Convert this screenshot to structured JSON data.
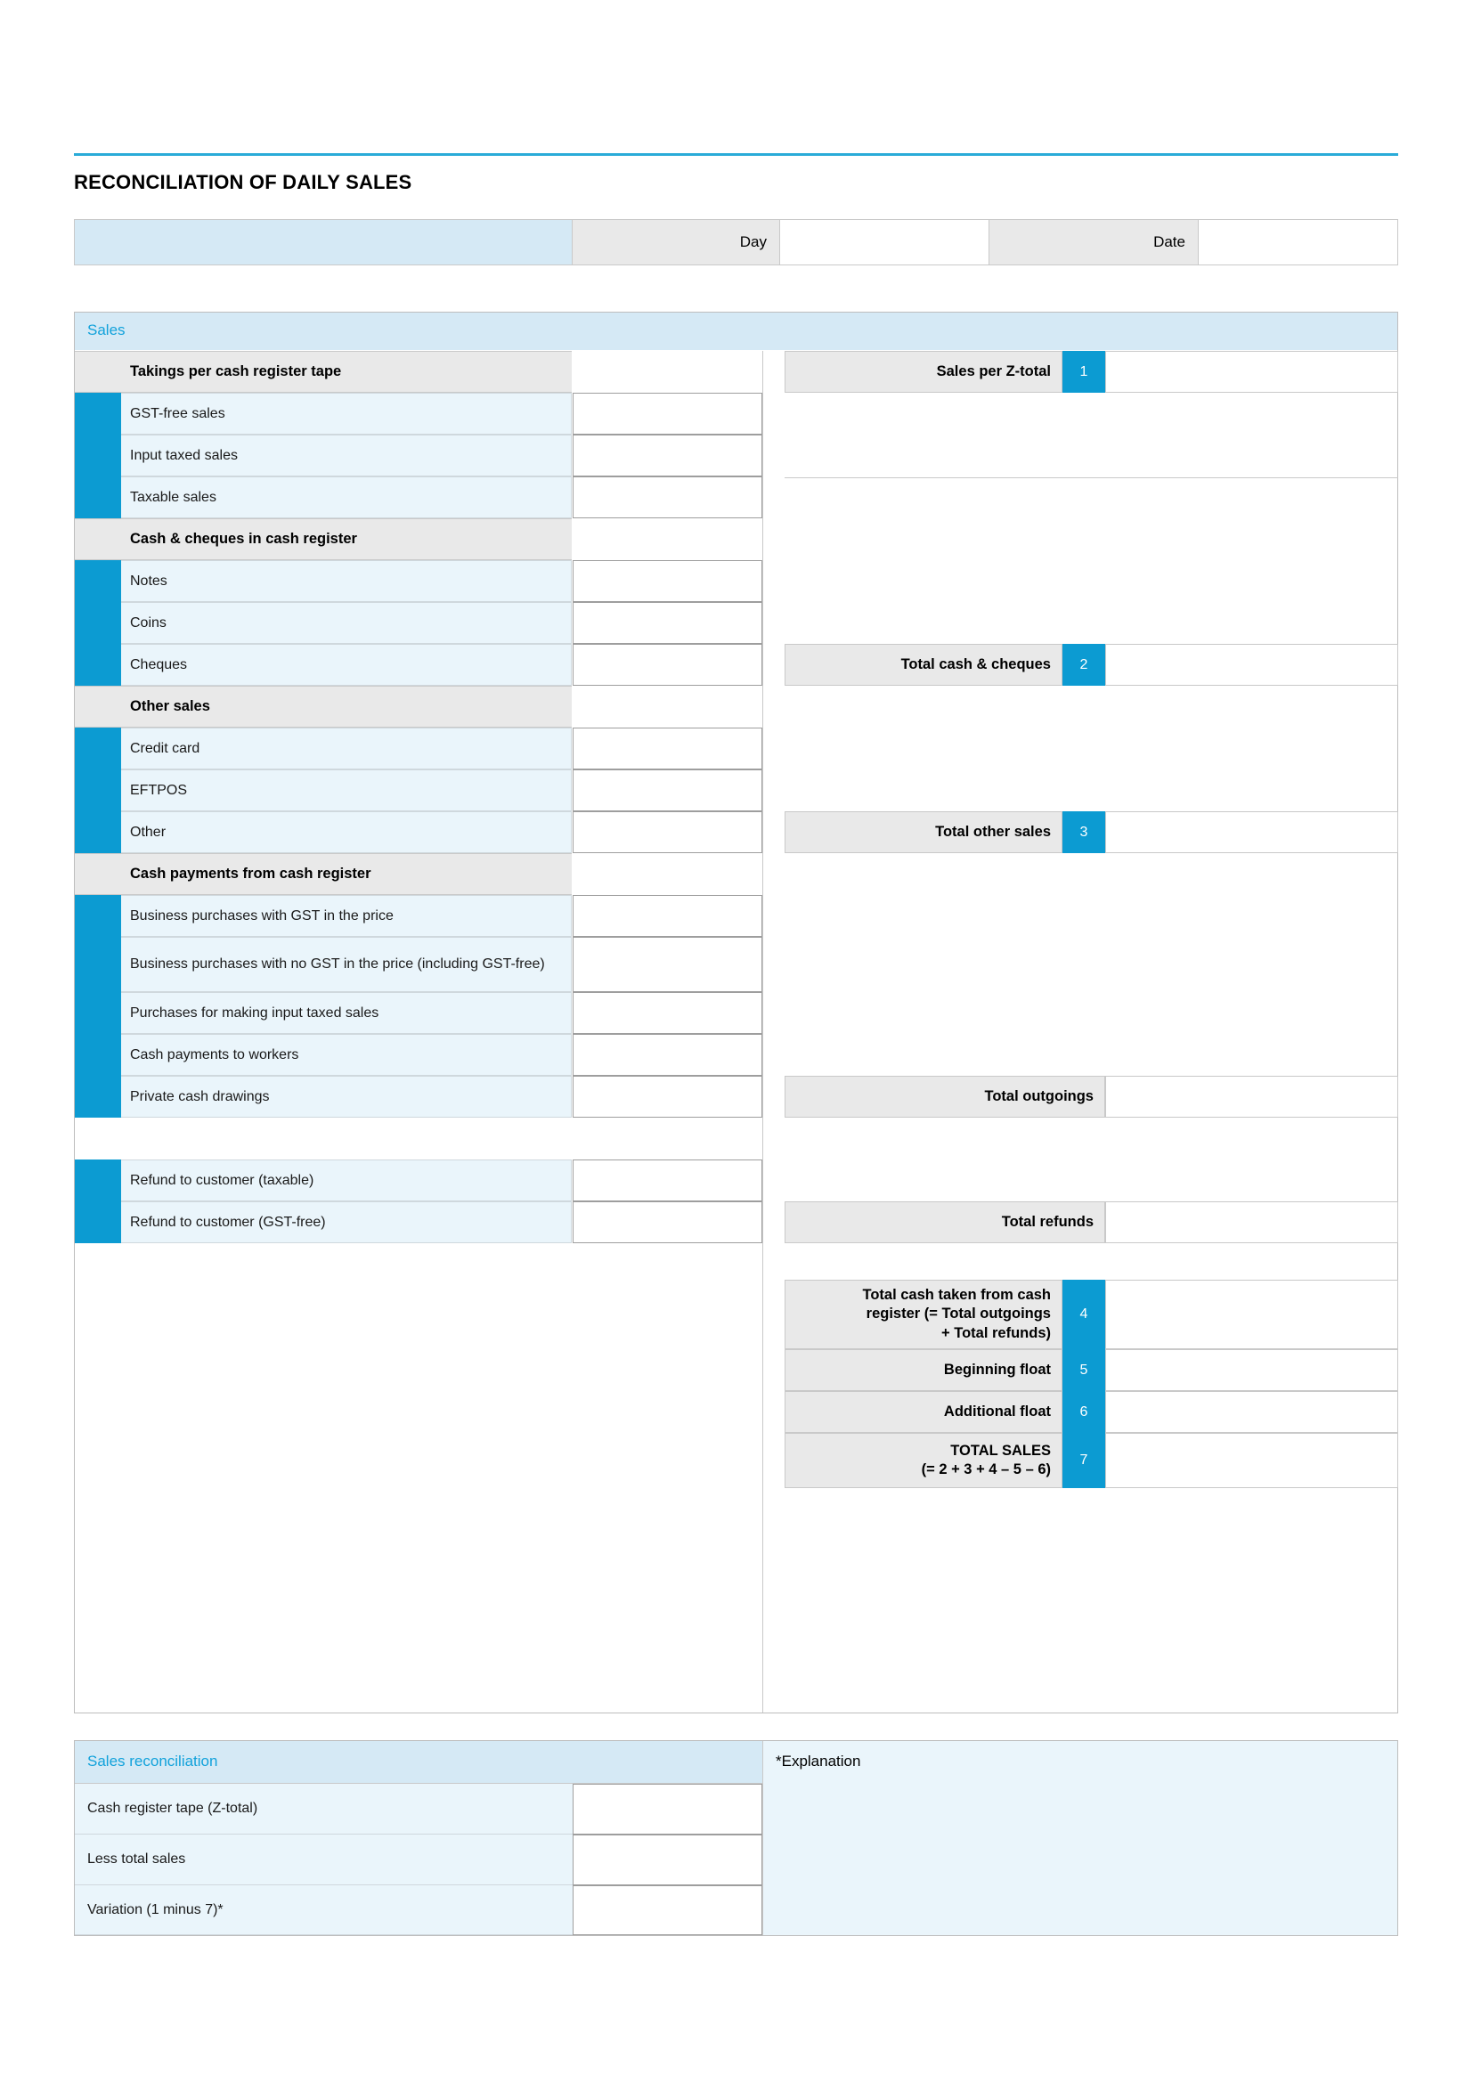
{
  "document": {
    "title": "RECONCILIATION OF DAILY SALES",
    "accent_blue": "#0C9BD2",
    "rule_blue": "#29ABD8",
    "header_light_blue": "#d5e9f5",
    "row_light_blue": "#eaf5fb",
    "grey": "#e9e9e9"
  },
  "header": {
    "day_label": "Day",
    "date_label": "Date",
    "day_value": "",
    "date_value": ""
  },
  "sales_section": {
    "title": "Sales",
    "groups": [
      {
        "category": "Takings per cash register tape",
        "category_value": "",
        "items": [
          {
            "label": "GST-free sales",
            "value": ""
          },
          {
            "label": "Input taxed sales",
            "value": ""
          },
          {
            "label": "Taxable sales",
            "value": ""
          }
        ]
      },
      {
        "category": "Cash & cheques in cash register",
        "category_value": "",
        "items": [
          {
            "label": "Notes",
            "value": ""
          },
          {
            "label": "Coins",
            "value": ""
          },
          {
            "label": "Cheques",
            "value": ""
          }
        ]
      },
      {
        "category": "Other sales",
        "category_value": "",
        "items": [
          {
            "label": "Credit card",
            "value": ""
          },
          {
            "label": "EFTPOS",
            "value": ""
          },
          {
            "label": "Other",
            "value": ""
          }
        ]
      },
      {
        "category": "Cash payments from cash register",
        "category_value": "",
        "items": [
          {
            "label": "Business purchases with GST in the price",
            "value": ""
          },
          {
            "label": "Business purchases with no GST in the price (including GST-free)",
            "value": ""
          },
          {
            "label": "Purchases for making input taxed sales",
            "value": ""
          },
          {
            "label": "Cash payments to workers",
            "value": ""
          },
          {
            "label": "Private cash drawings",
            "value": ""
          }
        ]
      },
      {
        "category": "",
        "category_value": "",
        "items": [
          {
            "label": "Refund to customer (taxable)",
            "value": ""
          },
          {
            "label": "Refund to customer (GST-free)",
            "value": ""
          }
        ]
      }
    ],
    "totals": [
      {
        "label": "Sales per Z-total",
        "number": "1",
        "value": ""
      },
      {
        "label": "Total cash & cheques",
        "number": "2",
        "value": ""
      },
      {
        "label": "Total other sales",
        "number": "3",
        "value": ""
      },
      {
        "label": "Total outgoings",
        "number": "",
        "value": ""
      },
      {
        "label": "Total refunds",
        "number": "",
        "value": ""
      },
      {
        "label": "Total cash taken from cash register  (= Total outgoings + Total refunds)",
        "number": "4",
        "value": ""
      },
      {
        "label": "Beginning float",
        "number": "5",
        "value": ""
      },
      {
        "label": "Additional float",
        "number": "6",
        "value": ""
      },
      {
        "label": "TOTAL SALES (= 2 + 3 + 4 – 5 – 6)",
        "number": "7",
        "value": ""
      }
    ],
    "total_labels": {
      "sales_z_total": "Sales per Z-total",
      "total_cash_cheques": "Total cash & cheques",
      "total_other_sales": "Total other sales",
      "total_outgoings": "Total outgoings",
      "total_refunds": "Total refunds",
      "total_cash_taken_line1": "Total cash taken from cash",
      "total_cash_taken_line2": "register  (= Total outgoings",
      "total_cash_taken_line3": "+ Total refunds)",
      "beginning_float": "Beginning float",
      "additional_float": "Additional float",
      "total_sales_line1": "TOTAL SALES",
      "total_sales_line2": "(= 2 + 3 + 4 – 5 – 6)"
    },
    "numbers": {
      "n1": "1",
      "n2": "2",
      "n3": "3",
      "n4": "4",
      "n5": "5",
      "n6": "6",
      "n7": "7"
    }
  },
  "reconciliation": {
    "title": "Sales reconciliation",
    "rows": [
      {
        "label": "Cash register tape (Z-total)",
        "value": ""
      },
      {
        "label": "Less total sales",
        "value": ""
      },
      {
        "label": "Variation (1 minus 7)*",
        "value": ""
      }
    ],
    "explanation_title": "*Explanation",
    "explanation_value": ""
  }
}
